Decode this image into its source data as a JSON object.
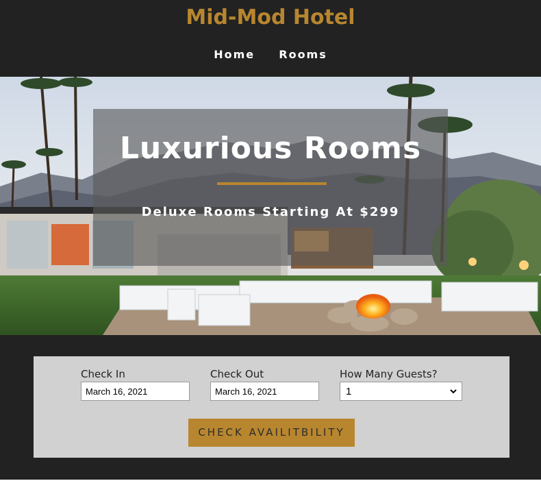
{
  "header": {
    "site_title": "Mid-Mod Hotel",
    "nav": [
      "Home",
      "Rooms"
    ]
  },
  "hero": {
    "title": "Luxurious Rooms",
    "subtitle": "Deluxe Rooms Starting At $299"
  },
  "booking": {
    "check_in": {
      "label": "Check In",
      "value": "March 16, 2021"
    },
    "check_out": {
      "label": "Check Out",
      "value": "March 16, 2021"
    },
    "guests": {
      "label": "How Many Guests?",
      "value": "1"
    },
    "button_label": "CHECK AVAILITBILITY"
  },
  "colors": {
    "accent": "#b8862f",
    "dark": "#222222",
    "panel": "#d1d1d1"
  }
}
